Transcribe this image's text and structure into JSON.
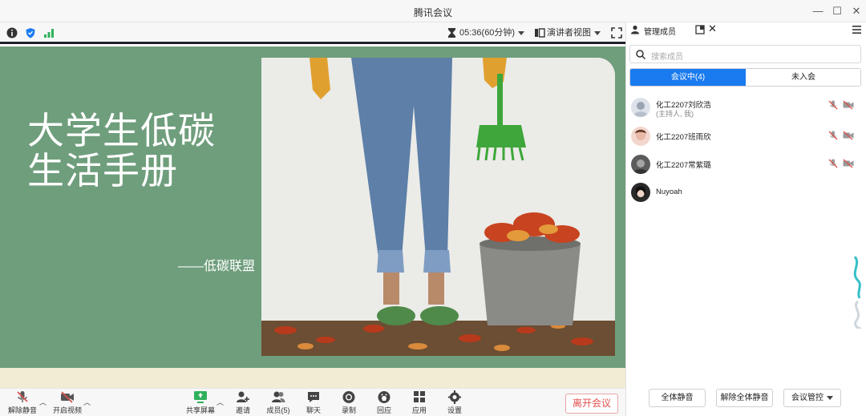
{
  "window": {
    "title": "腾讯会议"
  },
  "top_toolbar": {
    "timer": "05:36(60分钟)",
    "view_mode": "演讲者视图"
  },
  "slide": {
    "title_line1": "大学生低碳",
    "title_line2": "生活手册",
    "subtitle": "——低碳联盟"
  },
  "bottom_toolbar": {
    "unmute": "解除静音",
    "start_video": "开启视频",
    "share_screen": "共享屏幕",
    "invite": "邀请",
    "members": "成员(5)",
    "chat": "聊天",
    "record": "录制",
    "reactions": "回应",
    "apps": "应用",
    "settings": "设置",
    "leave": "离开会议"
  },
  "panel": {
    "title": "管理成员",
    "search_placeholder": "搜索成员",
    "tabs": [
      "会议中(4)",
      "未入会"
    ],
    "members": [
      {
        "name": "化工2207刘欣浩",
        "role": "(主持人, 我)"
      },
      {
        "name": "化工2207班雨欣",
        "role": ""
      },
      {
        "name": "化工2207常紫璐",
        "role": ""
      },
      {
        "name": "Nuyoah",
        "role": ""
      }
    ],
    "mute_all": "全体静音",
    "unmute_all": "解除全体静音",
    "meeting_control": "会议管控"
  },
  "colors": {
    "accent": "#1a7bf0",
    "slide_green": "#6f9e7c",
    "leave_red": "#e25050",
    "muted_mic": "#d9534f"
  }
}
